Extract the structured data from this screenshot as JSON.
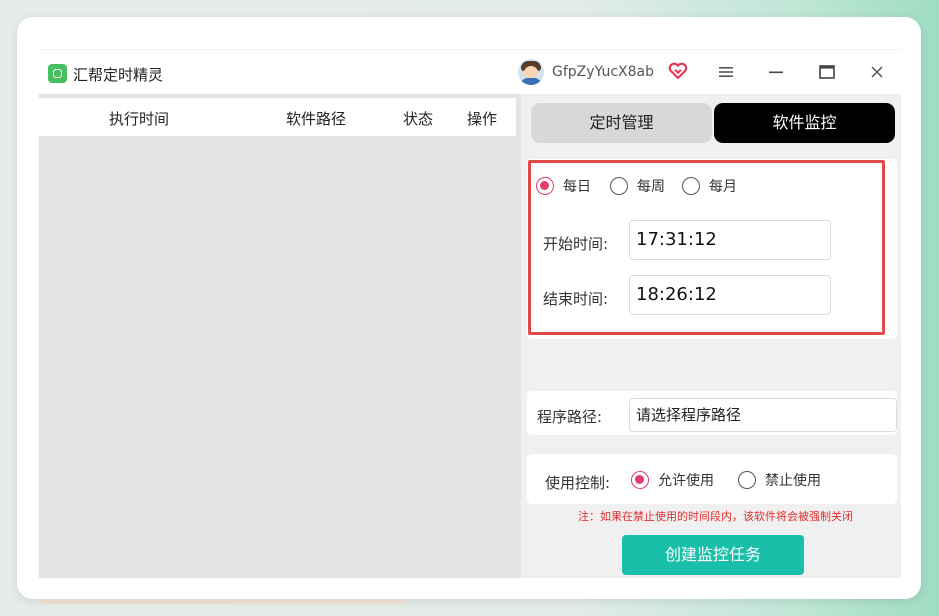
{
  "app": {
    "title": "汇帮定时精灵",
    "username": "GfpZyYucX8ab",
    "icons": [
      "app-logo-icon",
      "user-avatar-icon",
      "vip-heart-icon",
      "menu-icon",
      "minimize-icon",
      "maximize-icon",
      "close-icon"
    ]
  },
  "table": {
    "columns": [
      "执行时间",
      "软件路径",
      "状态",
      "操作"
    ],
    "rows": []
  },
  "tabs": [
    {
      "label": "定时管理",
      "active": false
    },
    {
      "label": "软件监控",
      "active": true
    }
  ],
  "frequency": {
    "options": [
      "每日",
      "每周",
      "每月"
    ],
    "selected": "每日"
  },
  "schedule": {
    "start_label": "开始时间:",
    "start_value": "17:31:12",
    "end_label": "结束时间:",
    "end_value": "18:26:12"
  },
  "program_path": {
    "label": "程序路径:",
    "placeholder": "请选择程序路径"
  },
  "usage_control": {
    "label": "使用控制:",
    "options": [
      "允许使用",
      "禁止使用"
    ],
    "selected": "允许使用"
  },
  "note": "注：如果在禁止使用的时间段内，该软件将会被强制关闭",
  "create_button": "创建监控任务",
  "colors": {
    "accent_radio": "#e33b6a",
    "highlight_border": "#e24a4a",
    "create_button": "#19bfa9",
    "active_tab": "#000000",
    "note_text": "#e03030"
  }
}
